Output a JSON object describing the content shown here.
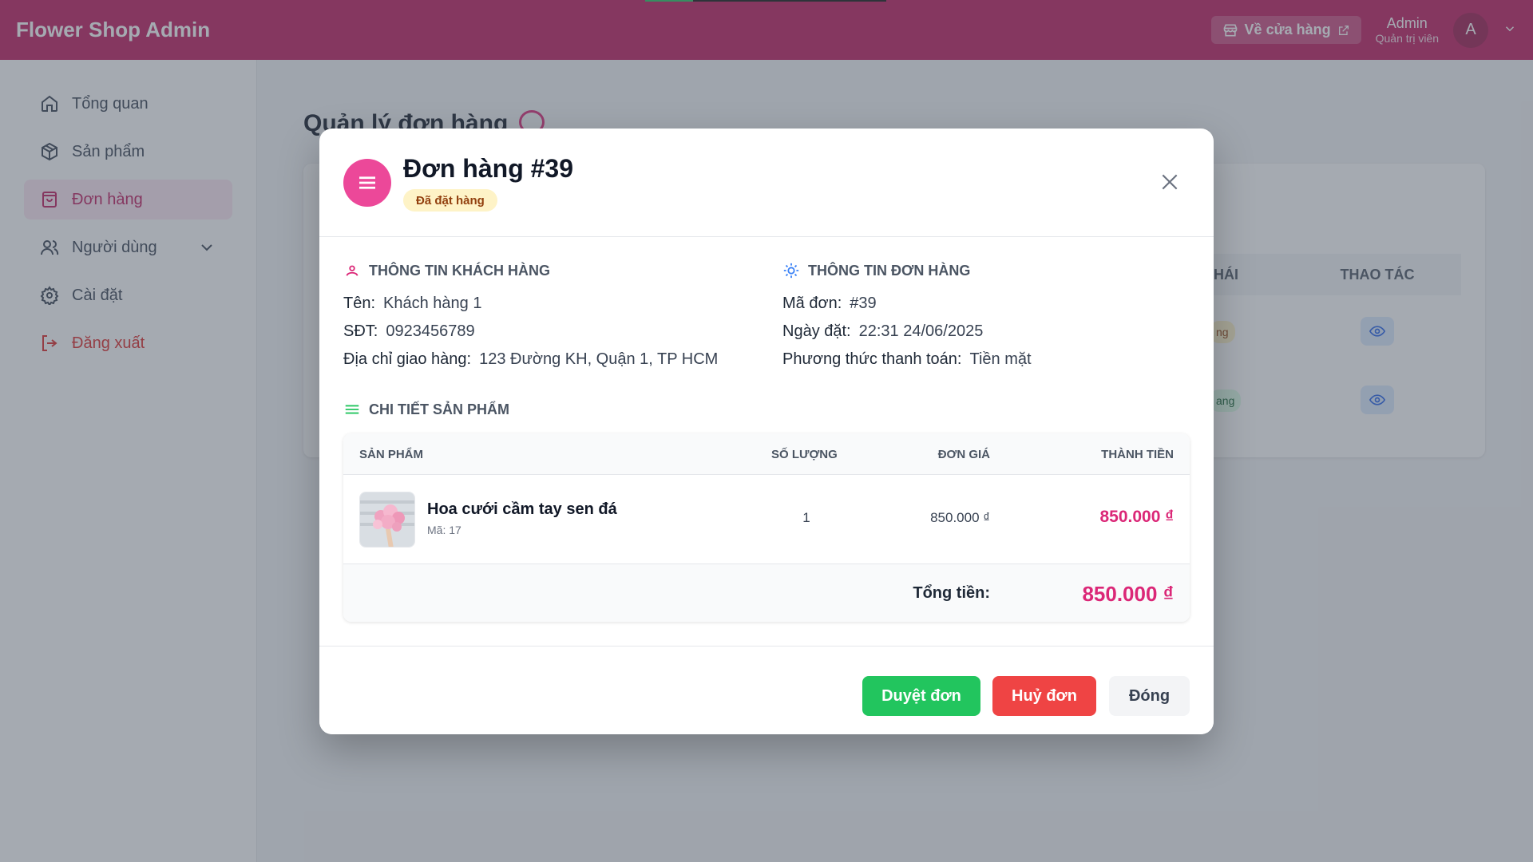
{
  "header": {
    "brand": "Flower Shop Admin",
    "store_link": "Về cửa hàng",
    "user_name": "Admin",
    "user_role": "Quản trị viên",
    "avatar_letter": "A"
  },
  "sidebar": {
    "items": [
      {
        "label": "Tổng quan",
        "icon": "home-icon"
      },
      {
        "label": "Sản phẩm",
        "icon": "package-icon"
      },
      {
        "label": "Đơn hàng",
        "icon": "shopping-bag-icon",
        "active": true
      },
      {
        "label": "Người dùng",
        "icon": "users-icon"
      },
      {
        "label": "Cài đặt",
        "icon": "gear-icon"
      },
      {
        "label": "Đăng xuất",
        "icon": "logout-icon"
      }
    ]
  },
  "page": {
    "title": "Quản lý đơn hàng",
    "table_headers_visible": [
      "HÁI",
      "THAO TÁC"
    ],
    "badges_visible": [
      "ng",
      "ang"
    ]
  },
  "modal": {
    "title": "Đơn hàng #39",
    "status": "Đã đặt hàng",
    "customer": {
      "section_title": "THÔNG TIN KHÁCH HÀNG",
      "name_label": "Tên:",
      "name": "Khách hàng 1",
      "phone_label": "SĐT:",
      "phone": "0923456789",
      "address_label": "Địa chỉ giao hàng:",
      "address": "123 Đường KH, Quận 1, TP HCM"
    },
    "order": {
      "section_title": "THÔNG TIN ĐƠN HÀNG",
      "code_label": "Mã đơn:",
      "code": "#39",
      "date_label": "Ngày đặt:",
      "date": "22:31 24/06/2025",
      "payment_label": "Phương thức thanh toán:",
      "payment": "Tiền mặt"
    },
    "products": {
      "section_title": "CHI TIẾT SẢN PHẨM",
      "headers": [
        "SẢN PHẨM",
        "SỐ LƯỢNG",
        "ĐƠN GIÁ",
        "THÀNH TIỀN"
      ],
      "rows": [
        {
          "name": "Hoa cưới cầm tay sen đá",
          "code": "Mã: 17",
          "qty": "1",
          "price": "850.000 ₫",
          "subtotal": "850.000 ₫"
        }
      ],
      "total_label": "Tổng tiền:",
      "total": "850.000 ₫"
    },
    "buttons": {
      "approve": "Duyệt đơn",
      "cancel": "Huỷ đơn",
      "close": "Đóng"
    }
  },
  "colors": {
    "brand": "#be185d",
    "accent_pink": "#db2777",
    "approve": "#22c55e",
    "cancel": "#ef4444"
  }
}
